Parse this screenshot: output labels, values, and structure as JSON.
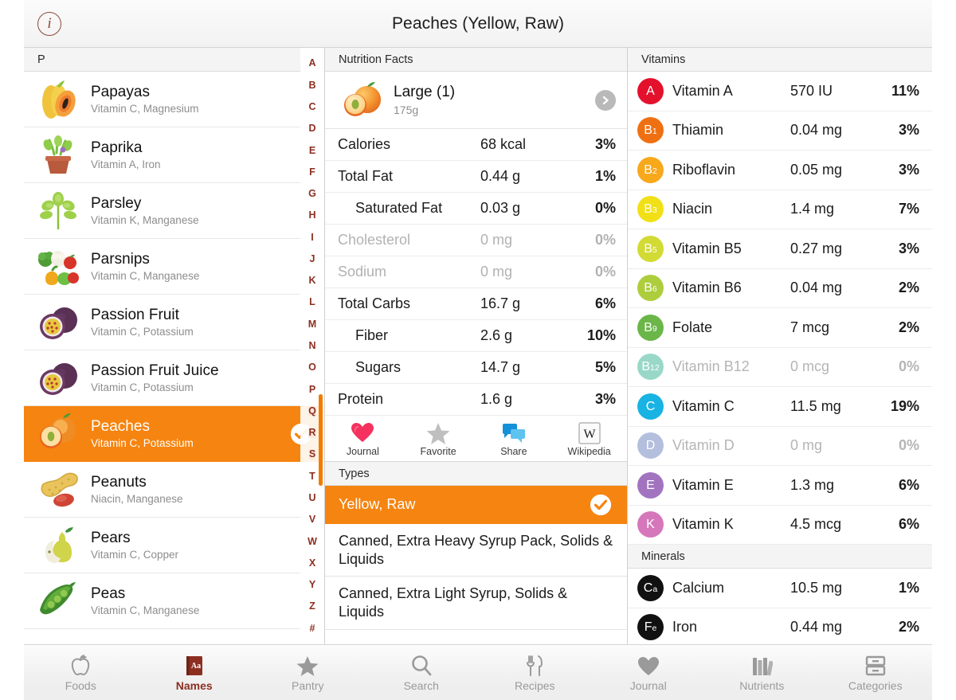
{
  "titlebar": {
    "info_icon": "info-icon",
    "title": "Peaches (Yellow, Raw)"
  },
  "left_panel": {
    "header": "P",
    "alphabet": [
      "A",
      "B",
      "C",
      "D",
      "E",
      "F",
      "G",
      "H",
      "I",
      "J",
      "K",
      "L",
      "M",
      "N",
      "O",
      "P",
      "Q",
      "R",
      "S",
      "T",
      "U",
      "V",
      "W",
      "X",
      "Y",
      "Z",
      "#"
    ],
    "highlighted_letters": [
      "Q",
      "R",
      "S"
    ],
    "items": [
      {
        "name": "Papayas",
        "nutrients": "Vitamin C, Magnesium",
        "icon": "papaya-icon",
        "selected": false
      },
      {
        "name": "Paprika",
        "nutrients": "Vitamin A, Iron",
        "icon": "paprika-plant-icon",
        "selected": false
      },
      {
        "name": "Parsley",
        "nutrients": "Vitamin K, Manganese",
        "icon": "parsley-icon",
        "selected": false
      },
      {
        "name": "Parsnips",
        "nutrients": "Vitamin C, Manganese",
        "icon": "vegetables-icon",
        "selected": false
      },
      {
        "name": "Passion Fruit",
        "nutrients": "Vitamin C, Potassium",
        "icon": "passion-fruit-icon",
        "selected": false
      },
      {
        "name": "Passion Fruit Juice",
        "nutrients": "Vitamin C, Potassium",
        "icon": "passion-fruit-icon",
        "selected": false
      },
      {
        "name": "Peaches",
        "nutrients": "Vitamin C, Potassium",
        "icon": "peach-icon",
        "selected": true
      },
      {
        "name": "Peanuts",
        "nutrients": "Niacin, Manganese",
        "icon": "peanut-icon",
        "selected": false
      },
      {
        "name": "Pears",
        "nutrients": "Vitamin C, Copper",
        "icon": "pear-icon",
        "selected": false
      },
      {
        "name": "Peas",
        "nutrients": "Vitamin C, Manganese",
        "icon": "pea-pod-icon",
        "selected": false
      }
    ]
  },
  "nutrition_facts": {
    "header": "Nutrition Facts",
    "serving": {
      "icon": "peach-icon",
      "title": "Large (1)",
      "grams": "175g",
      "disclosure_icon": "chevron-right-icon"
    },
    "rows": [
      {
        "label": "Calories",
        "value": "68 kcal",
        "pct": "3%",
        "indent": false,
        "zero": false
      },
      {
        "label": "Total Fat",
        "value": "0.44 g",
        "pct": "1%",
        "indent": false,
        "zero": false
      },
      {
        "label": "Saturated Fat",
        "value": "0.03 g",
        "pct": "0%",
        "indent": true,
        "zero": false
      },
      {
        "label": "Cholesterol",
        "value": "0 mg",
        "pct": "0%",
        "indent": false,
        "zero": true
      },
      {
        "label": "Sodium",
        "value": "0 mg",
        "pct": "0%",
        "indent": false,
        "zero": true
      },
      {
        "label": "Total Carbs",
        "value": "16.7 g",
        "pct": "6%",
        "indent": false,
        "zero": false
      },
      {
        "label": "Fiber",
        "value": "2.6 g",
        "pct": "10%",
        "indent": true,
        "zero": false
      },
      {
        "label": "Sugars",
        "value": "14.7 g",
        "pct": "5%",
        "indent": true,
        "zero": false
      },
      {
        "label": "Protein",
        "value": "1.6 g",
        "pct": "3%",
        "indent": false,
        "zero": false
      }
    ],
    "actions": [
      {
        "label": "Journal",
        "icon": "heart-icon"
      },
      {
        "label": "Favorite",
        "icon": "star-icon"
      },
      {
        "label": "Share",
        "icon": "speech-bubbles-icon"
      },
      {
        "label": "Wikipedia",
        "icon": "wikipedia-icon"
      }
    ]
  },
  "types": {
    "header": "Types",
    "items": [
      {
        "label": "Yellow, Raw",
        "selected": true
      },
      {
        "label": "Canned, Extra Heavy Syrup Pack, Solids & Liquids",
        "selected": false
      },
      {
        "label": "Canned, Extra Light Syrup, Solids & Liquids",
        "selected": false
      }
    ]
  },
  "vitamins": {
    "header": "Vitamins",
    "items": [
      {
        "badge": "A",
        "name": "Vitamin A",
        "value": "570 IU",
        "pct": "11%",
        "color": "#e3112c",
        "zero": false
      },
      {
        "badge": "B1",
        "name": "Thiamin",
        "value": "0.04 mg",
        "pct": "3%",
        "color": "#ef7012",
        "zero": false
      },
      {
        "badge": "B2",
        "name": "Riboflavin",
        "value": "0.05 mg",
        "pct": "3%",
        "color": "#f7a81b",
        "zero": false
      },
      {
        "badge": "B3",
        "name": "Niacin",
        "value": "1.4 mg",
        "pct": "7%",
        "color": "#f2e017",
        "zero": false
      },
      {
        "badge": "B5",
        "name": "Vitamin B5",
        "value": "0.27 mg",
        "pct": "3%",
        "color": "#d2da34",
        "zero": false
      },
      {
        "badge": "B6",
        "name": "Vitamin B6",
        "value": "0.04 mg",
        "pct": "2%",
        "color": "#aecd3c",
        "zero": false
      },
      {
        "badge": "B9",
        "name": "Folate",
        "value": "7 mcg",
        "pct": "2%",
        "color": "#6ab648",
        "zero": false
      },
      {
        "badge": "B12",
        "name": "Vitamin B12",
        "value": "0 mcg",
        "pct": "0%",
        "color": "#57bfa6",
        "zero": true
      },
      {
        "badge": "C",
        "name": "Vitamin C",
        "value": "11.5 mg",
        "pct": "19%",
        "color": "#18b3e3",
        "zero": false
      },
      {
        "badge": "D",
        "name": "Vitamin D",
        "value": "0 mg",
        "pct": "0%",
        "color": "#8196c8",
        "zero": true
      },
      {
        "badge": "E",
        "name": "Vitamin E",
        "value": "1.3 mg",
        "pct": "6%",
        "color": "#a274c0",
        "zero": false
      },
      {
        "badge": "K",
        "name": "Vitamin K",
        "value": "4.5 mcg",
        "pct": "6%",
        "color": "#d677bb",
        "zero": false
      }
    ]
  },
  "minerals": {
    "header": "Minerals",
    "items": [
      {
        "badge": "Ca",
        "name": "Calcium",
        "value": "10.5 mg",
        "pct": "1%",
        "color": "#111111",
        "zero": false
      },
      {
        "badge": "Fe",
        "name": "Iron",
        "value": "0.44 mg",
        "pct": "2%",
        "color": "#111111",
        "zero": false
      }
    ]
  },
  "tabbar": {
    "items": [
      {
        "label": "Foods",
        "icon": "apple-icon",
        "active": false
      },
      {
        "label": "Names",
        "icon": "book-aa-icon",
        "active": true
      },
      {
        "label": "Pantry",
        "icon": "star-icon",
        "active": false
      },
      {
        "label": "Search",
        "icon": "search-icon",
        "active": false
      },
      {
        "label": "Recipes",
        "icon": "fork-knife-icon",
        "active": false
      },
      {
        "label": "Journal",
        "icon": "heart-icon",
        "active": false
      },
      {
        "label": "Nutrients",
        "icon": "books-icon",
        "active": false
      },
      {
        "label": "Categories",
        "icon": "drawers-icon",
        "active": false
      }
    ]
  },
  "colors": {
    "accent_orange": "#f68410",
    "brand_maroon": "#8c2f21"
  }
}
